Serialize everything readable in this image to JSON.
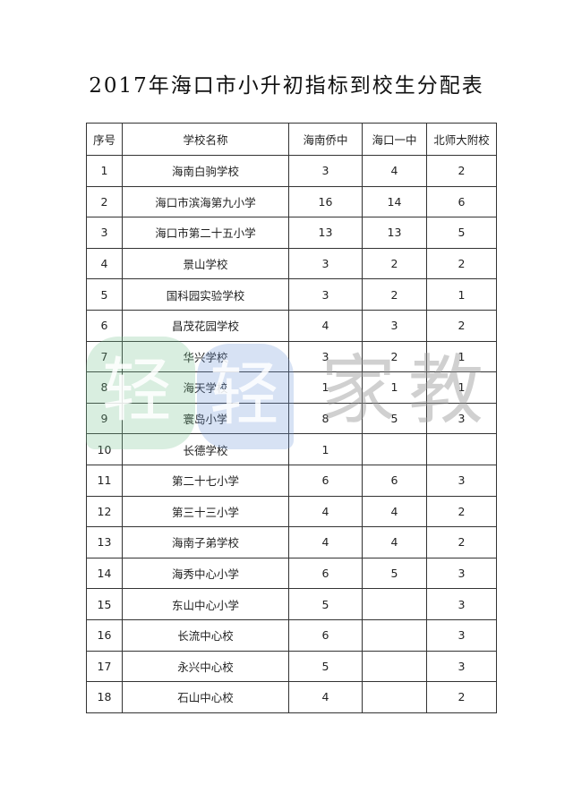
{
  "title": "2017年海口市小升初指标到校生分配表",
  "table": {
    "headers": [
      "序号",
      "学校名称",
      "海南侨中",
      "海口一中",
      "北师大附校"
    ],
    "rows": [
      [
        "1",
        "海南白驹学校",
        "3",
        "4",
        "2"
      ],
      [
        "2",
        "海口市滨海第九小学",
        "16",
        "14",
        "6"
      ],
      [
        "3",
        "海口市第二十五小学",
        "13",
        "13",
        "5"
      ],
      [
        "4",
        "景山学校",
        "3",
        "2",
        "2"
      ],
      [
        "5",
        "国科园实验学校",
        "3",
        "2",
        "1"
      ],
      [
        "6",
        "昌茂花园学校",
        "4",
        "3",
        "2"
      ],
      [
        "7",
        "华兴学校",
        "3",
        "2",
        "1"
      ],
      [
        "8",
        "海天学校",
        "1",
        "1",
        "1"
      ],
      [
        "9",
        "寰岛小学",
        "8",
        "5",
        "3"
      ],
      [
        "10",
        "长德学校",
        "1",
        "",
        ""
      ],
      [
        "11",
        "第二十七小学",
        "6",
        "6",
        "3"
      ],
      [
        "12",
        "第三十三小学",
        "4",
        "4",
        "2"
      ],
      [
        "13",
        "海南子弟学校",
        "4",
        "4",
        "2"
      ],
      [
        "14",
        "海秀中心小学",
        "6",
        "5",
        "3"
      ],
      [
        "15",
        "东山中心小学",
        "5",
        "",
        "3"
      ],
      [
        "16",
        "长流中心校",
        "6",
        "",
        "3"
      ],
      [
        "17",
        "永兴中心校",
        "5",
        "",
        "3"
      ],
      [
        "18",
        "石山中心校",
        "4",
        "",
        "2"
      ]
    ]
  },
  "watermark": {
    "chars": [
      "轻",
      "轻",
      "家",
      "教"
    ]
  }
}
